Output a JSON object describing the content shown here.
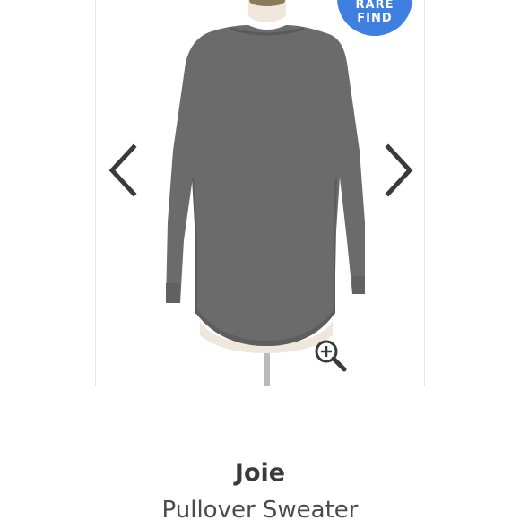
{
  "badge": {
    "line1": "RARE",
    "line2": "FIND",
    "color": "#3f7fe0"
  },
  "gallery": {
    "prev_icon": "chevron-left-icon",
    "next_icon": "chevron-right-icon",
    "zoom_icon": "zoom-in-icon"
  },
  "product": {
    "brand": "Joie",
    "name": "Pullover Sweater",
    "color": "#6b6b6b"
  }
}
